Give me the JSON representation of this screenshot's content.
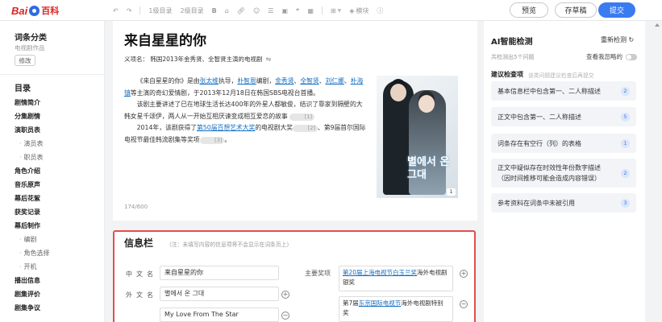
{
  "logo": {
    "text_left": "Bai",
    "text_right": "百科"
  },
  "toolbar": {
    "undo_icon": "undo-icon",
    "redo_icon": "redo-icon",
    "h1_label": "1级目录",
    "h2_label": "2级目录",
    "bold_label": "B",
    "module_label": "模块"
  },
  "buttons": {
    "preview": "预览",
    "save_draft": "存草稿",
    "submit": "提交"
  },
  "sidebar": {
    "category_title": "词条分类",
    "category_value": "电视剧作品",
    "edit_button": "修改",
    "toc_title": "目录",
    "toc_items": [
      {
        "label": "剧情简介",
        "sub": false
      },
      {
        "label": "分集剧情",
        "sub": false
      },
      {
        "label": "演职员表",
        "sub": false
      },
      {
        "label": "演员表",
        "sub": true
      },
      {
        "label": "职员表",
        "sub": true
      },
      {
        "label": "角色介绍",
        "sub": false
      },
      {
        "label": "音乐原声",
        "sub": false
      },
      {
        "label": "幕后花絮",
        "sub": false
      },
      {
        "label": "获奖记录",
        "sub": false
      },
      {
        "label": "幕后制作",
        "sub": false
      },
      {
        "label": "编剧",
        "sub": true
      },
      {
        "label": "角色选择",
        "sub": true
      },
      {
        "label": "开机",
        "sub": true
      },
      {
        "label": "播出信息",
        "sub": false
      },
      {
        "label": "剧集评价",
        "sub": false
      },
      {
        "label": "剧集争议",
        "sub": false
      }
    ]
  },
  "editor": {
    "title": "来自星星的你",
    "meaning": "义项名： 韩国2013年金秀贤、全智贤主演的电视剧",
    "p1": {
      "a": "《来自星星的你》是由",
      "director": "张太维",
      "b": "执导，",
      "writer": "朴智恩",
      "c": "编剧，",
      "act1": "金秀贤",
      "d": "、",
      "act2": "全智贤",
      "e": "、",
      "act3": "刘仁娜",
      "f": "、",
      "act4": "朴海镇",
      "g": "等主演的奇幻爱情剧，于2013年12月18日在韩国SBS电视台首播。",
      "h": "该剧主要讲述了已在地球生活长达400年的外星人都敏俊，结识了靠家到隔壁的大韩女星千颂伊，两人从一开始互相厌谏变成相互爱恋的故事",
      "cite1": "[1]"
    },
    "p2": {
      "a": "2014年，该剧获得了",
      "award": "第50届百想艺术大奖",
      "b": "的电视剧大奖",
      "cite1": "[2]",
      "c": "、第9届首尔国际电视节最佳韩流剧集等奖项",
      "cite2": "[3]",
      "d": "。"
    },
    "counter": "174/600",
    "poster_text": "별에서 온 그대",
    "poster_badge": "1"
  },
  "infobox": {
    "title": "信息栏",
    "note": "（注：未填写内容的信息项将不会显示在词条页上）",
    "cn_name_label": "中文名",
    "cn_name_value": "来自星星的你",
    "foreign_name_label": "外文名",
    "foreign_value_1": "별에서 온 그대",
    "foreign_value_2": "My Love From The Star",
    "awards_label": "主要奖项",
    "award1_link": "第20届上海电视节白玉兰奖",
    "award1_text": "海外电视剧银奖",
    "award2_prefix": "第7届",
    "award2_link": "东京国际电视节",
    "award2_text": "海外电视剧特别奖"
  },
  "right_panel": {
    "title": "AI智能检测",
    "recheck": "重新检测",
    "count": "共检测出5个问题",
    "view_ignored": "查看我忽略的",
    "suggestions_title": "建议检查项",
    "suggestions_sub": "该类问题建议检查后再提交",
    "items": [
      {
        "text": "基本信息栏中包含第一、二人称描述",
        "count": "2"
      },
      {
        "text": "正文中包含第一、二人称描述",
        "count": "5"
      },
      {
        "text": "词条存在有空行（列）的表格",
        "count": "1"
      },
      {
        "text": "正文中疑似存在时效性年份数字描述（因时间推移可能会造成内容错误）",
        "count": "2"
      },
      {
        "text": "参考资料在词条中未被引用",
        "count": "3"
      }
    ]
  }
}
